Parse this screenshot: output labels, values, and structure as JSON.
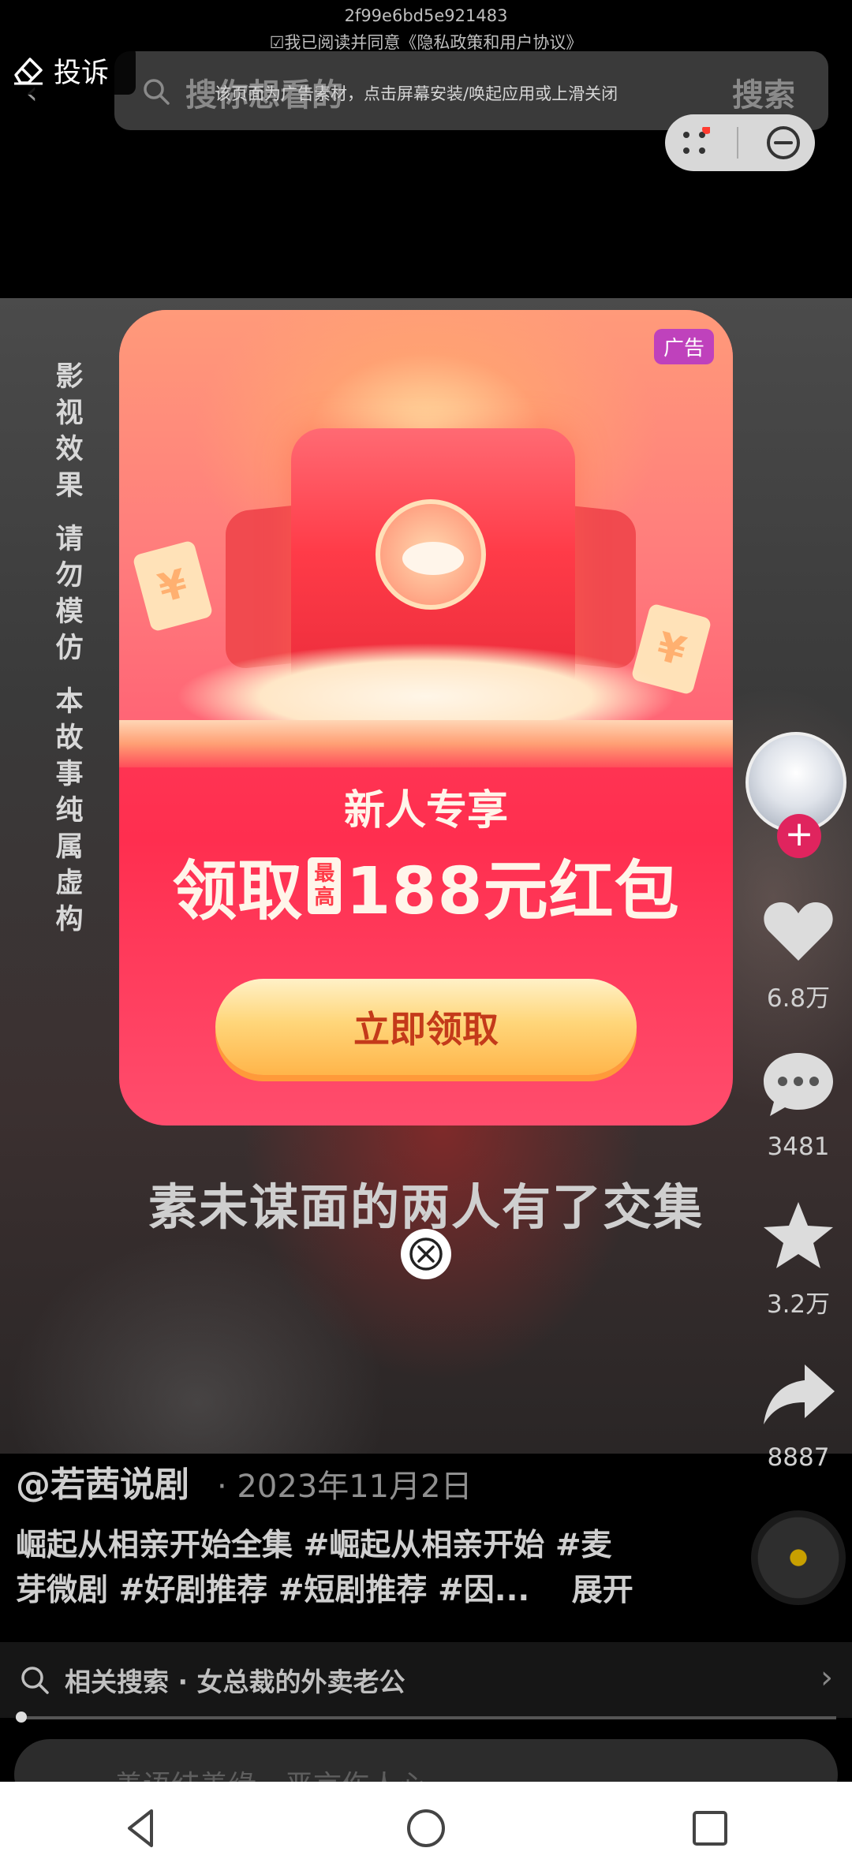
{
  "top": {
    "ad_id": "2f99e6bd5e921483",
    "agreement": "☑我已阅读并同意《隐私政策和用户协议》",
    "complain_label": "投诉",
    "search_placeholder": "搜你想看的",
    "ad_notice": "该页面为广告素材，点击屏幕安装/唤起应用或上滑关闭",
    "search_button": "搜索"
  },
  "video": {
    "disclaimer": [
      "影视效果",
      "请勿模仿",
      "本故事纯属虚构"
    ],
    "subtitle": "素未谋面的两人有了交集"
  },
  "side": {
    "likes": "6.8万",
    "comments": "3481",
    "favorites": "3.2万",
    "shares": "8887"
  },
  "info": {
    "author": "@若茜说剧",
    "date": "· 2023年11月2日",
    "desc_line1": "崛起从相亲开始全集 #崛起从相亲开始 #麦",
    "desc_line2": "芽微剧 #好剧推荐 #短剧推荐 #因...",
    "expand": "展开",
    "related_search": "相关搜索 · 女总裁的外卖老公",
    "comment_placeholder": "善语结善缘，恶言伤人心"
  },
  "ad": {
    "label": "广告",
    "subtitle": "新人专享",
    "main_pre": "领取",
    "main_tag": "最高",
    "main_post": "188元红包",
    "button": "立即领取"
  },
  "colors": {
    "accent_red": "#ff3b48",
    "button_text": "#c43a1a",
    "follow_pink": "#e0245e"
  }
}
